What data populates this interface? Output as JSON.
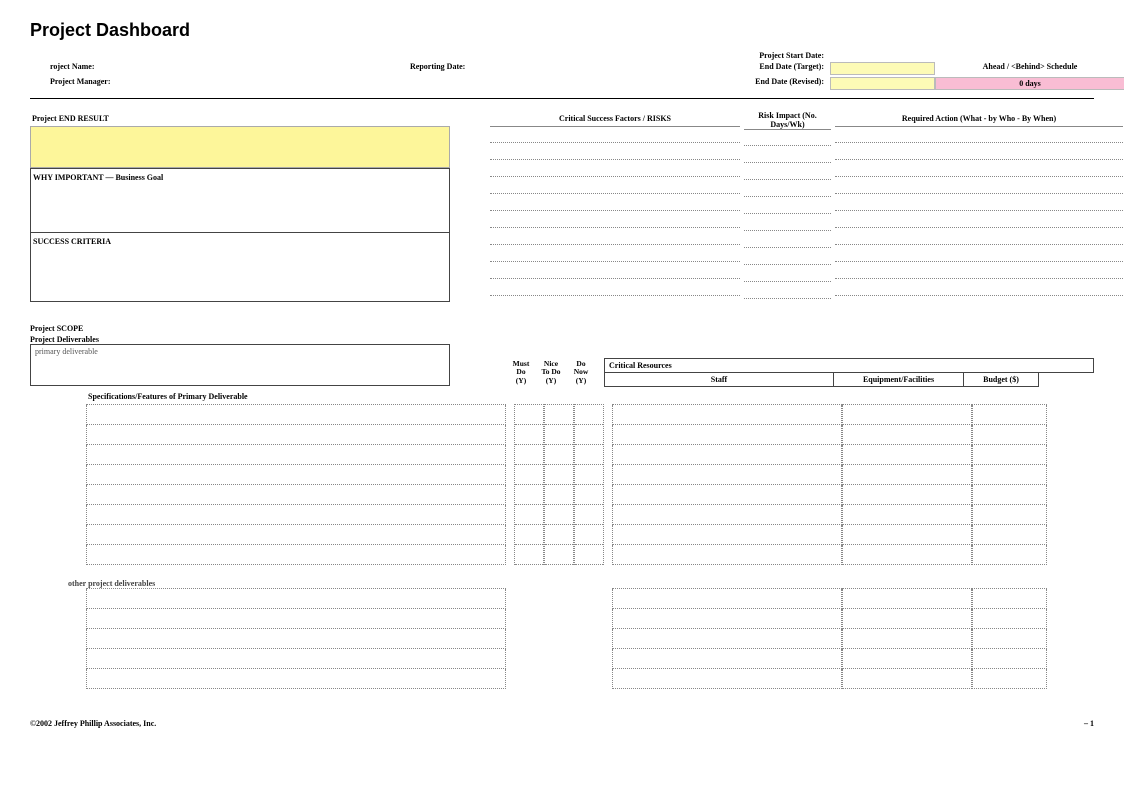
{
  "title": "Project Dashboard",
  "header": {
    "project_name_label": "roject Name:",
    "project_manager_label": "Project Manager:",
    "reporting_date_label": "Reporting Date:",
    "start_date_label": "Project Start Date:",
    "end_target_label": "End Date (Target):",
    "end_revised_label": "End Date (Revised):",
    "schedule_label": "Ahead / <Behind> Schedule",
    "schedule_value": "0 days"
  },
  "upper": {
    "end_result_label": "Project END RESULT",
    "why_important_label": "WHY IMPORTANT   —   Business Goal",
    "success_criteria_label": "SUCCESS CRITERIA",
    "csf_label": "Critical Success Factors  /  RISKS",
    "risk_impact_label": "Risk Impact (No. Days/Wk)",
    "required_action_label": "Required Action   (What - by Who - By When)"
  },
  "scope": {
    "scope_label": "Project SCOPE",
    "deliverables_label": "Project Deliverables",
    "primary_placeholder": "primary deliverable",
    "must_do": "Must Do (Y)",
    "nice_to_do": "Nice To Do (Y)",
    "do_now": "Do Now (Y)",
    "critical_resources": "Critical Resources",
    "staff": "Staff",
    "equipment": "Equipment/Facilities",
    "budget": "Budget ($)",
    "spec_label": "Specifications/Features of Primary Deliverable",
    "other_label": "other project deliverables"
  },
  "footer": {
    "copyright": "©2002 Jeffrey Phillip Associates, Inc.",
    "page": "– 1"
  }
}
